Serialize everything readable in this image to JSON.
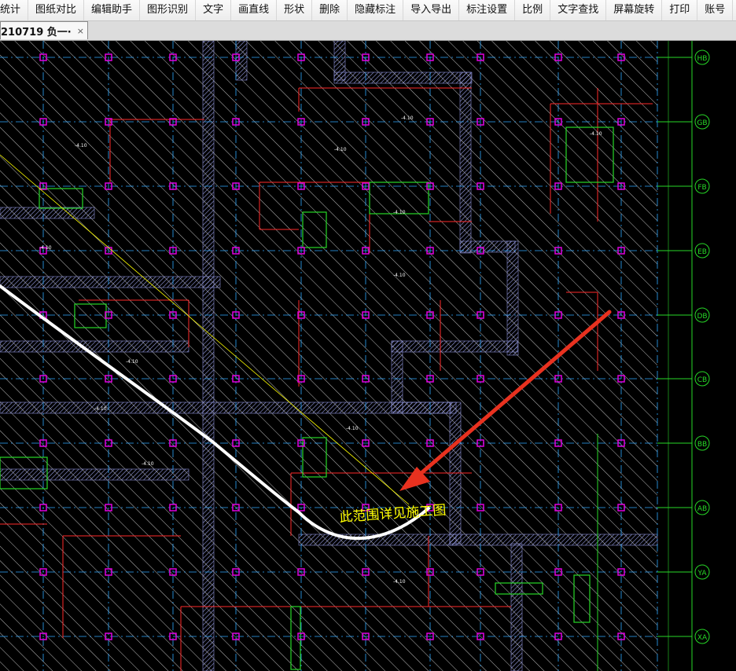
{
  "menubar": {
    "items": [
      {
        "label": "统计",
        "name": "menu-statistics"
      },
      {
        "label": "图纸对比",
        "name": "menu-drawing-compare"
      },
      {
        "label": "编辑助手",
        "name": "menu-edit-assistant"
      },
      {
        "label": "图形识别",
        "name": "menu-shape-recognition"
      },
      {
        "label": "文字",
        "name": "menu-text"
      },
      {
        "label": "画直线",
        "name": "menu-draw-line"
      },
      {
        "label": "形状",
        "name": "menu-shape"
      },
      {
        "label": "删除",
        "name": "menu-delete"
      },
      {
        "label": "隐藏标注",
        "name": "menu-hide-annotations"
      },
      {
        "label": "导入导出",
        "name": "menu-import-export"
      },
      {
        "label": "标注设置",
        "name": "menu-annotation-settings"
      },
      {
        "label": "比例",
        "name": "menu-scale"
      },
      {
        "label": "文字查找",
        "name": "menu-text-search"
      },
      {
        "label": "屏幕旋转",
        "name": "menu-screen-rotate"
      },
      {
        "label": "打印",
        "name": "menu-print"
      },
      {
        "label": "账号",
        "name": "menu-account"
      }
    ]
  },
  "tab": {
    "label": "210719  负一·",
    "close": "×"
  },
  "drawing": {
    "note": "此范围详见施工图",
    "axis_labels": [
      "HB",
      "GB",
      "FB",
      "EB",
      "DB",
      "CB",
      "BB",
      "AB",
      "YA",
      "XA"
    ],
    "elevation_labels": [
      "-4.10",
      "-4.10",
      "-4.10",
      "-4.10",
      "-4.10",
      "-4.10",
      "-4.10",
      "-4.10",
      "-4.10",
      "-4.10",
      "-4.10",
      "-4.10"
    ],
    "colors": {
      "background": "#000000",
      "hatch": "#bfbfbf",
      "grid": "#2fa8ff",
      "wall": "#8a8fd8",
      "red": "#ff2a2a",
      "green": "#27d827",
      "magenta": "#e000e0",
      "yellow": "#ffff00",
      "white": "#ffffff",
      "arrow": "#e8311f"
    }
  }
}
